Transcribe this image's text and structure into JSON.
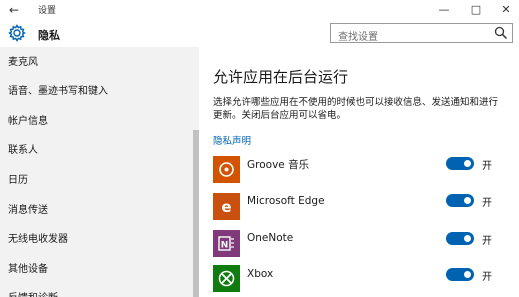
{
  "window": {
    "title": "设置",
    "back_glyph": "←",
    "minimize_glyph": "—",
    "maximize_glyph": "□",
    "close_glyph": "✕"
  },
  "header": {
    "title": "隐私",
    "icon": "gear-icon",
    "search_placeholder": "查找设置",
    "search_icon": "search-icon"
  },
  "sidebar": {
    "items": [
      {
        "label": "麦克风"
      },
      {
        "label": "语音、墨迹书写和键入"
      },
      {
        "label": "帐户信息"
      },
      {
        "label": "联系人"
      },
      {
        "label": "日历"
      },
      {
        "label": "消息传送"
      },
      {
        "label": "无线电收发器"
      },
      {
        "label": "其他设备"
      },
      {
        "label": "反馈和诊断"
      }
    ]
  },
  "main": {
    "title": "允许应用在后台运行",
    "description": "选择允许哪些应用在不使用的时候也可以接收信息、发送通知和进行更新。关闭后台应用可以省电。",
    "privacy_link": "隐私声明",
    "apps": [
      {
        "name": "Groove 音乐",
        "icon": "groove-music-icon",
        "color": "#d35400",
        "toggle": "开",
        "on": true
      },
      {
        "name": "Microsoft Edge",
        "icon": "edge-icon",
        "color": "#ca5010",
        "toggle": "开",
        "on": true
      },
      {
        "name": "OneNote",
        "icon": "onenote-icon",
        "color": "#80397b",
        "toggle": "开",
        "on": true
      },
      {
        "name": "Xbox",
        "icon": "xbox-icon",
        "color": "#107c10",
        "toggle": "开",
        "on": true
      }
    ]
  },
  "colors": {
    "accent": "#0063b1",
    "sidebar_bg": "#f2f2f2"
  }
}
